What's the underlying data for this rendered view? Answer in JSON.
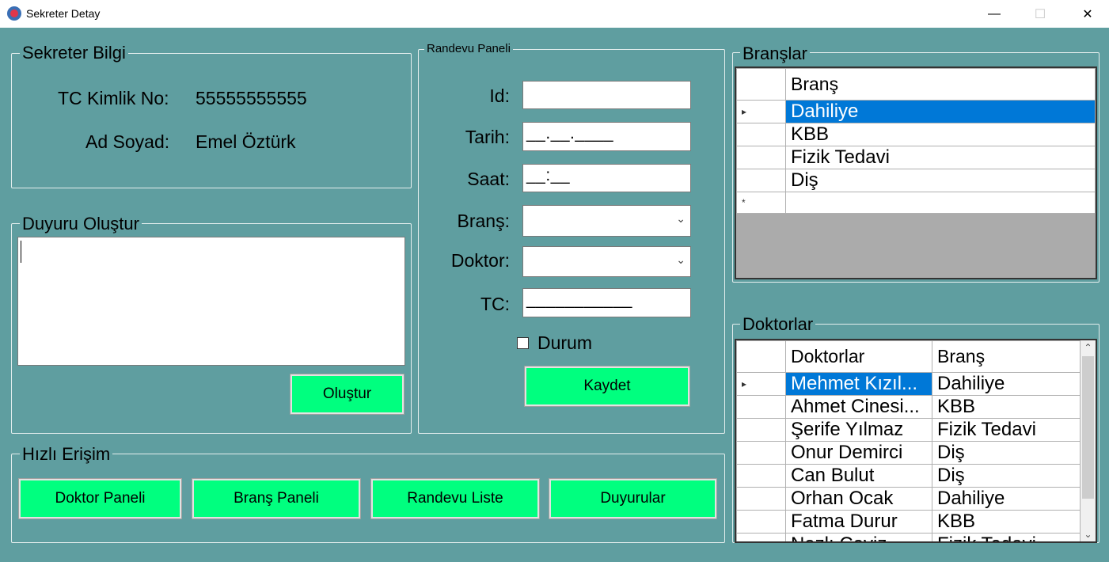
{
  "window": {
    "title": "Sekreter Detay",
    "minimize": "—",
    "maximize": "☐",
    "close": "✕"
  },
  "sekreter_bilgi": {
    "legend": "Sekreter Bilgi",
    "tc_label": "TC Kimlik No:",
    "tc_value": "55555555555",
    "name_label": "Ad Soyad:",
    "name_value": "Emel Öztürk"
  },
  "duyuru": {
    "legend": "Duyuru Oluştur",
    "text": "",
    "create_button": "Oluştur"
  },
  "randevu": {
    "legend": "Randevu Paneli",
    "id_label": "Id:",
    "id_value": "",
    "tarih_label": "Tarih:",
    "tarih_value": "__.__.____",
    "saat_label": "Saat:",
    "saat_value": "__:__",
    "brans_label": "Branş:",
    "brans_value": "",
    "doktor_label": "Doktor:",
    "doktor_value": "",
    "tc_label": "TC:",
    "tc_value": "___________",
    "durum_label": "Durum",
    "save_button": "Kaydet"
  },
  "hizli_erisim": {
    "legend": "Hızlı Erişim",
    "buttons": [
      "Doktor Paneli",
      "Branş Paneli",
      "Randevu Liste",
      "Duyurular"
    ]
  },
  "branslar": {
    "legend": "Branşlar",
    "header": "Branş",
    "rows": [
      "Dahiliye",
      "KBB",
      "Fizik Tedavi",
      "Diş"
    ],
    "row_marker": "▸",
    "new_row_marker": "*"
  },
  "doktorlar": {
    "legend": "Doktorlar",
    "headers": [
      "Doktorlar",
      "Branş"
    ],
    "rows": [
      [
        "Mehmet Kızıl...",
        "Dahiliye"
      ],
      [
        "Ahmet Cinesi...",
        "KBB"
      ],
      [
        "Şerife Yılmaz",
        "Fizik Tedavi"
      ],
      [
        "Onur Demirci",
        "Diş"
      ],
      [
        "Can Bulut",
        "Diş"
      ],
      [
        "Orhan Ocak",
        "Dahiliye"
      ],
      [
        "Fatma Durur",
        "KBB"
      ],
      [
        "Nazlı Ceviz",
        "Fizik Tedavi"
      ]
    ],
    "row_marker": "▸"
  }
}
